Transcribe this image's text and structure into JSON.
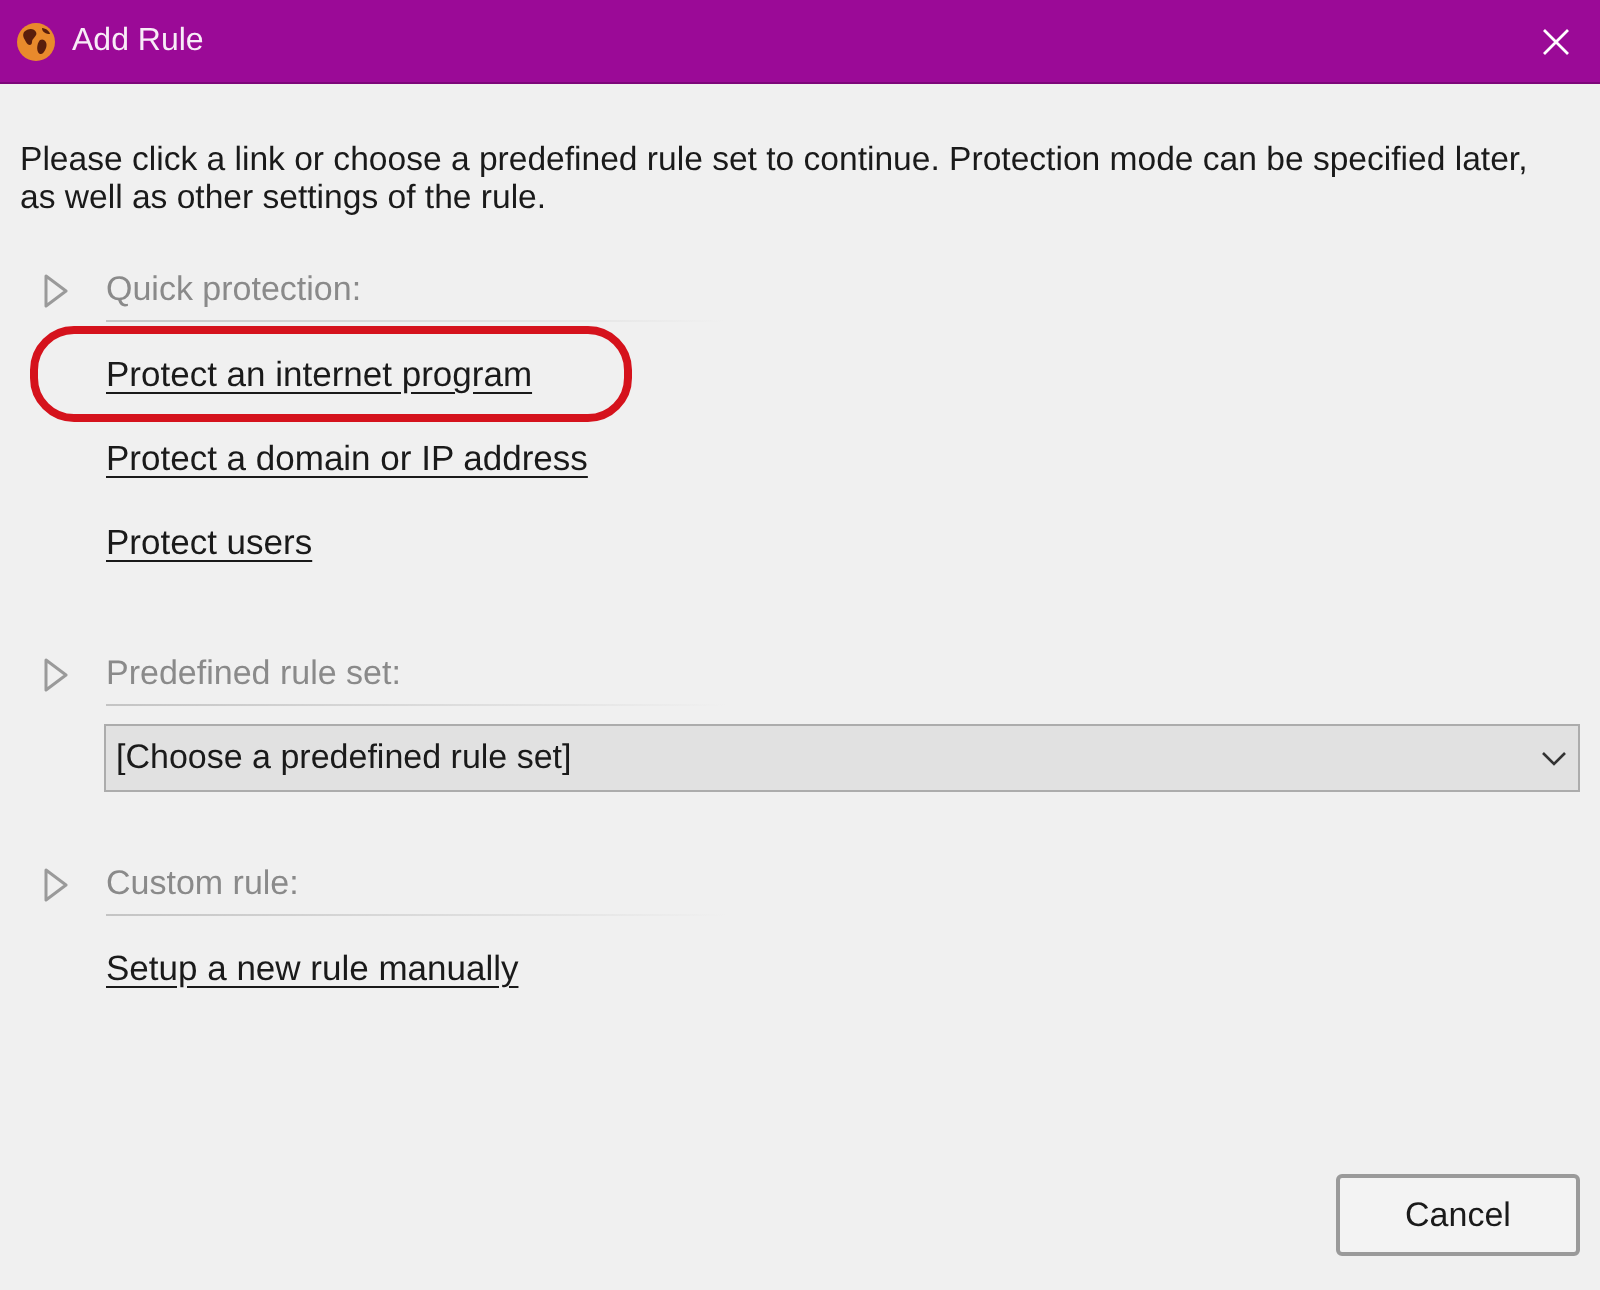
{
  "window": {
    "title": "Add Rule"
  },
  "intro": "Please click a link or choose a predefined rule set to continue. Protection mode can be specified later, as well as other settings of the rule.",
  "sections": [
    {
      "kind": "links",
      "title": "Quick protection:",
      "links": [
        {
          "label": "Protect an internet program",
          "circled": true
        },
        {
          "label": "Protect a domain or IP address",
          "circled": false
        },
        {
          "label": "Protect users",
          "circled": false
        }
      ]
    },
    {
      "kind": "dropdown",
      "title": "Predefined rule set:",
      "dropdown": {
        "value": "[Choose a predefined rule set]"
      }
    },
    {
      "kind": "links",
      "title": "Custom rule:",
      "links": [
        {
          "label": "Setup a new rule manually",
          "circled": false
        }
      ]
    }
  ],
  "buttons": [
    "Cancel"
  ]
}
